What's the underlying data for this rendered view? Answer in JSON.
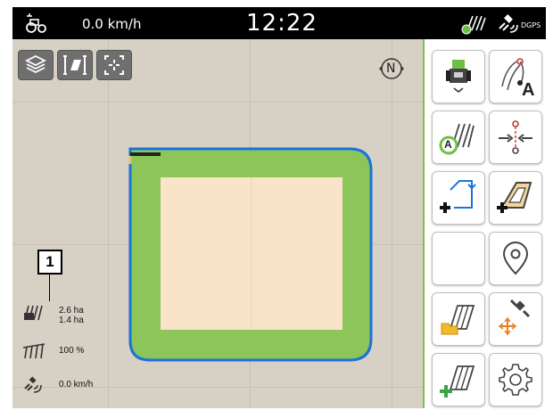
{
  "status_bar": {
    "speed": "0.0 km/h",
    "clock": "12:22",
    "gps_label": "DGPS",
    "icons": [
      "tractor-icon",
      "section-control-icon",
      "gps-satellite-icon"
    ]
  },
  "map": {
    "compass_label": "N",
    "controls": [
      "layers-icon",
      "view-mode-icon",
      "center-view-icon"
    ],
    "callout_number": "1"
  },
  "field_info": {
    "area_total": "2.6 ha",
    "area_worked": "1.4 ha",
    "boom_percent": "100 %",
    "speed": "0.0 km/h"
  },
  "sidebar": {
    "buttons": [
      "vehicle-icon",
      "guidance-line-a-icon",
      "section-control-auto-icon",
      "set-point-icon",
      "add-boundary-icon",
      "add-headland-icon",
      "empty-slot",
      "location-pin-icon",
      "open-field-icon",
      "move-gps-icon",
      "new-field-icon",
      "settings-gear-icon"
    ],
    "guidance_letter": "A",
    "section_letter": "A"
  },
  "colors": {
    "field_boundary": "#1a73d9",
    "headland": "#8cc65a",
    "field_interior": "#f9e4c9",
    "map_background": "#d7d0c5",
    "accent": "#7cc14a"
  }
}
